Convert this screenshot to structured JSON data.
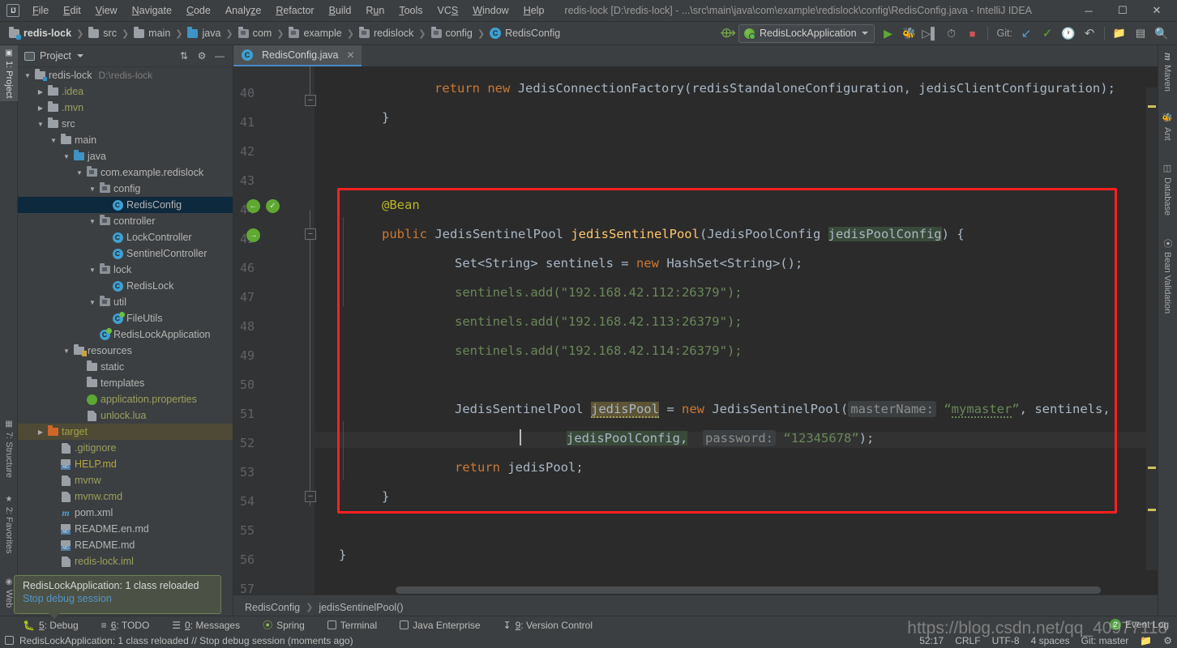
{
  "titlebar": {
    "logo": "IJ",
    "menus": [
      "File",
      "Edit",
      "View",
      "Navigate",
      "Code",
      "Analyze",
      "Refactor",
      "Build",
      "Run",
      "Tools",
      "VCS",
      "Window",
      "Help"
    ],
    "window_title": "redis-lock [D:\\redis-lock] - ...\\src\\main\\java\\com\\example\\redislock\\config\\RedisConfig.java - IntelliJ IDEA",
    "minimize": "─",
    "maximize": "☐",
    "close": "✕"
  },
  "navbar": {
    "breadcrumbs": [
      "redis-lock",
      "src",
      "main",
      "java",
      "com",
      "example",
      "redislock",
      "config",
      "RedisConfig"
    ],
    "run_config": "RedisLockApplication",
    "git_label": "Git:",
    "icons": [
      "build-icon",
      "run-icon",
      "debug-icon",
      "run-with-coverage-icon",
      "profile-icon",
      "stop-icon",
      "update-project-icon",
      "commit-icon",
      "history-icon",
      "rollback-icon",
      "project-structure-icon",
      "terminal-icon",
      "search-everywhere-icon"
    ]
  },
  "left_strip": {
    "tabs": [
      {
        "label": "1: Project",
        "icon": "project-icon",
        "active": true
      },
      {
        "label": "7: Structure",
        "icon": "structure-icon",
        "active": false
      },
      {
        "label": "2: Favorites",
        "icon": "star-icon",
        "active": false
      },
      {
        "label": "Web",
        "icon": "web-icon",
        "active": false
      }
    ]
  },
  "right_strip": {
    "tabs": [
      {
        "label": "Maven",
        "icon": "maven-icon"
      },
      {
        "label": "Ant",
        "icon": "ant-icon"
      },
      {
        "label": "Database",
        "icon": "database-icon"
      },
      {
        "label": "Bean Validation",
        "icon": "bean-validation-icon"
      }
    ]
  },
  "project_panel": {
    "title": "Project",
    "actions": [
      "collapse-all-icon",
      "settings-gear-icon",
      "hide-icon"
    ],
    "tree": [
      {
        "depth": 0,
        "twist": "▼",
        "icon": "module-folder-icon",
        "label": "redis-lock",
        "path": "D:\\redis-lock",
        "bold": true,
        "color": "",
        "state": ""
      },
      {
        "depth": 1,
        "twist": "▶",
        "icon": "folder-icon",
        "label": ".idea",
        "path": "",
        "bold": false,
        "color": "green",
        "state": ""
      },
      {
        "depth": 1,
        "twist": "▶",
        "icon": "folder-icon",
        "label": ".mvn",
        "path": "",
        "bold": false,
        "color": "green",
        "state": ""
      },
      {
        "depth": 1,
        "twist": "▼",
        "icon": "folder-icon",
        "label": "src",
        "path": "",
        "bold": false,
        "color": "",
        "state": ""
      },
      {
        "depth": 2,
        "twist": "▼",
        "icon": "folder-icon",
        "label": "main",
        "path": "",
        "bold": false,
        "color": "",
        "state": ""
      },
      {
        "depth": 3,
        "twist": "▼",
        "icon": "source-folder-icon",
        "label": "java",
        "path": "",
        "bold": false,
        "color": "",
        "state": ""
      },
      {
        "depth": 4,
        "twist": "▼",
        "icon": "package-icon",
        "label": "com.example.redislock",
        "path": "",
        "bold": false,
        "color": "",
        "state": ""
      },
      {
        "depth": 5,
        "twist": "▼",
        "icon": "package-icon",
        "label": "config",
        "path": "",
        "bold": false,
        "color": "",
        "state": ""
      },
      {
        "depth": 6,
        "twist": "",
        "icon": "class-icon",
        "label": "RedisConfig",
        "path": "",
        "bold": false,
        "color": "",
        "state": "selected"
      },
      {
        "depth": 5,
        "twist": "▼",
        "icon": "package-icon",
        "label": "controller",
        "path": "",
        "bold": false,
        "color": "",
        "state": ""
      },
      {
        "depth": 6,
        "twist": "",
        "icon": "class-icon",
        "label": "LockController",
        "path": "",
        "bold": false,
        "color": "",
        "state": ""
      },
      {
        "depth": 6,
        "twist": "",
        "icon": "class-icon",
        "label": "SentinelController",
        "path": "",
        "bold": false,
        "color": "",
        "state": ""
      },
      {
        "depth": 5,
        "twist": "▼",
        "icon": "package-icon",
        "label": "lock",
        "path": "",
        "bold": false,
        "color": "",
        "state": ""
      },
      {
        "depth": 6,
        "twist": "",
        "icon": "class-icon",
        "label": "RedisLock",
        "path": "",
        "bold": false,
        "color": "",
        "state": ""
      },
      {
        "depth": 5,
        "twist": "▼",
        "icon": "package-icon",
        "label": "util",
        "path": "",
        "bold": false,
        "color": "",
        "state": ""
      },
      {
        "depth": 6,
        "twist": "",
        "icon": "class-run-icon",
        "label": "FileUtils",
        "path": "",
        "bold": false,
        "color": "",
        "state": ""
      },
      {
        "depth": 5,
        "twist": "",
        "icon": "spring-class-icon",
        "label": "RedisLockApplication",
        "path": "",
        "bold": false,
        "color": "",
        "state": ""
      },
      {
        "depth": 3,
        "twist": "▼",
        "icon": "resources-folder-icon",
        "label": "resources",
        "path": "",
        "bold": false,
        "color": "",
        "state": ""
      },
      {
        "depth": 4,
        "twist": "",
        "icon": "folder-icon",
        "label": "static",
        "path": "",
        "bold": false,
        "color": "",
        "state": ""
      },
      {
        "depth": 4,
        "twist": "",
        "icon": "folder-icon",
        "label": "templates",
        "path": "",
        "bold": false,
        "color": "",
        "state": ""
      },
      {
        "depth": 4,
        "twist": "",
        "icon": "spring-properties-icon",
        "label": "application.properties",
        "path": "",
        "bold": false,
        "color": "green",
        "state": ""
      },
      {
        "depth": 4,
        "twist": "",
        "icon": "file-icon",
        "label": "unlock.lua",
        "path": "",
        "bold": false,
        "color": "green",
        "state": ""
      },
      {
        "depth": 1,
        "twist": "▶",
        "icon": "excluded-folder-icon",
        "label": "target",
        "path": "",
        "bold": false,
        "color": "olive",
        "state": "highlighted"
      },
      {
        "depth": 2,
        "twist": "",
        "icon": "gitignore-icon",
        "label": ".gitignore",
        "path": "",
        "bold": false,
        "color": "green",
        "state": ""
      },
      {
        "depth": 2,
        "twist": "",
        "icon": "markdown-icon",
        "label": "HELP.md",
        "path": "",
        "bold": false,
        "color": "yellow",
        "state": ""
      },
      {
        "depth": 2,
        "twist": "",
        "icon": "script-icon",
        "label": "mvnw",
        "path": "",
        "bold": false,
        "color": "green",
        "state": ""
      },
      {
        "depth": 2,
        "twist": "",
        "icon": "file-icon",
        "label": "mvnw.cmd",
        "path": "",
        "bold": false,
        "color": "green",
        "state": ""
      },
      {
        "depth": 2,
        "twist": "",
        "icon": "maven-pom-icon",
        "label": "pom.xml",
        "path": "",
        "bold": false,
        "color": "",
        "state": ""
      },
      {
        "depth": 2,
        "twist": "",
        "icon": "markdown-icon",
        "label": "README.en.md",
        "path": "",
        "bold": false,
        "color": "",
        "state": ""
      },
      {
        "depth": 2,
        "twist": "",
        "icon": "markdown-icon",
        "label": "README.md",
        "path": "",
        "bold": false,
        "color": "",
        "state": ""
      },
      {
        "depth": 2,
        "twist": "",
        "icon": "iml-icon",
        "label": "redis-lock.iml",
        "path": "",
        "bold": false,
        "color": "green",
        "state": ""
      }
    ]
  },
  "balloon": {
    "message": "RedisLockApplication: 1 class reloaded",
    "link": "Stop debug session"
  },
  "editor": {
    "tab_label": "RedisConfig.java",
    "tab_close": "✕",
    "line_numbers": [
      "40",
      "41",
      "42",
      "43",
      "44",
      "45",
      "46",
      "47",
      "48",
      "49",
      "50",
      "51",
      "52",
      "53",
      "54",
      "55",
      "56",
      "57"
    ],
    "lines": [
      {
        "n": "40",
        "text": "        return new JedisConnectionFactory(redisStandaloneConfiguration, jedisClientConfiguration);"
      },
      {
        "n": "41",
        "text": "    }"
      },
      {
        "n": "42",
        "text": ""
      },
      {
        "n": "43",
        "text": ""
      },
      {
        "n": "44",
        "text": "    @Bean"
      },
      {
        "n": "45",
        "text": "    public JedisSentinelPool jedisSentinelPool(JedisPoolConfig jedisPoolConfig) {"
      },
      {
        "n": "46",
        "text": "        Set<String> sentinels = new HashSet<String>();"
      },
      {
        "n": "47",
        "text": "        sentinels.add(\"192.168.42.112:26379\");"
      },
      {
        "n": "48",
        "text": "        sentinels.add(\"192.168.42.113:26379\");"
      },
      {
        "n": "49",
        "text": "        sentinels.add(\"192.168.42.114:26379\");"
      },
      {
        "n": "50",
        "text": ""
      },
      {
        "n": "51",
        "text": "        JedisSentinelPool jedisPool = new JedisSentinelPool( masterName: \"mymaster\", sentinels,"
      },
      {
        "n": "52",
        "text": "                jedisPoolConfig,  password: \"12345678\");"
      },
      {
        "n": "53",
        "text": "        return jedisPool;"
      },
      {
        "n": "54",
        "text": "    }"
      },
      {
        "n": "55",
        "text": ""
      },
      {
        "n": "56",
        "text": "}"
      },
      {
        "n": "57",
        "text": ""
      }
    ],
    "tokens": {
      "return": "return",
      "new": "new",
      "public": "public",
      "bean_annotation": "@Bean",
      "jedis_connection_factory": "JedisConnectionFactory(redisStandaloneConfiguration, jedisClientConfiguration);",
      "closing_brace": "}",
      "jedis_sentinel_pool_type": "JedisSentinelPool",
      "jedis_sentinel_pool_method": "jedisSentinelPool",
      "jedis_pool_config_type": "JedisPoolConfig",
      "jedis_pool_config_param": "jedisPoolConfig",
      "set_string": "Set<String> sentinels = ",
      "hashset": "HashSet<String>();",
      "sentinel_1": "sentinels.add(\"192.168.42.112:26379\");",
      "sentinel_2": "sentinels.add(\"192.168.42.113:26379\");",
      "sentinel_3": "sentinels.add(\"192.168.42.114:26379\");",
      "jedis_pool_var": "jedisPool",
      "master_name_hint": "masterName:",
      "master_name_value": "mymaster",
      "sentinels_arg": "sentinels,",
      "password_hint": "password:",
      "password_value": "12345678",
      "return_jedis_pool": "jedisPool;"
    },
    "breadcrumbs": [
      "RedisConfig",
      "jedisSentinelPool()"
    ]
  },
  "toolwindows": [
    {
      "num": "5",
      "label": ": Debug",
      "icon": "debug-bug-icon"
    },
    {
      "num": "6",
      "label": ": TODO",
      "icon": "todo-list-icon"
    },
    {
      "num": "0",
      "label": ": Messages",
      "icon": "messages-icon"
    },
    {
      "num": "",
      "label": "Spring",
      "icon": "spring-leaf-icon"
    },
    {
      "num": "",
      "label": "Terminal",
      "icon": "terminal-icon"
    },
    {
      "num": "",
      "label": "Java Enterprise",
      "icon": "java-enterprise-icon"
    },
    {
      "num": "9",
      "label": ": Version Control",
      "icon": "version-control-icon"
    }
  ],
  "statusbar": {
    "message": "RedisLockApplication: 1 class reloaded // Stop debug session (moments ago)",
    "caret_position": "52:17",
    "line_separator": "CRLF",
    "encoding": "UTF-8",
    "indent": "4 spaces",
    "branch": "Git: master",
    "event_log": "Event Log",
    "event_count": "2"
  },
  "watermark": "https://blog.csdn.net/qq_40977118",
  "colors": {
    "accent_blue": "#4a88c7",
    "selection_blue": "#0d293e",
    "highlight_olive": "#4e4a36",
    "red_box": "#ff2020",
    "editor_bg": "#2b2b2b",
    "chrome_bg": "#3c3f41",
    "string_green": "#6a8759",
    "keyword_orange": "#cc7832",
    "annotation_yellow": "#bbb529",
    "method_yellow": "#ffc66d"
  }
}
